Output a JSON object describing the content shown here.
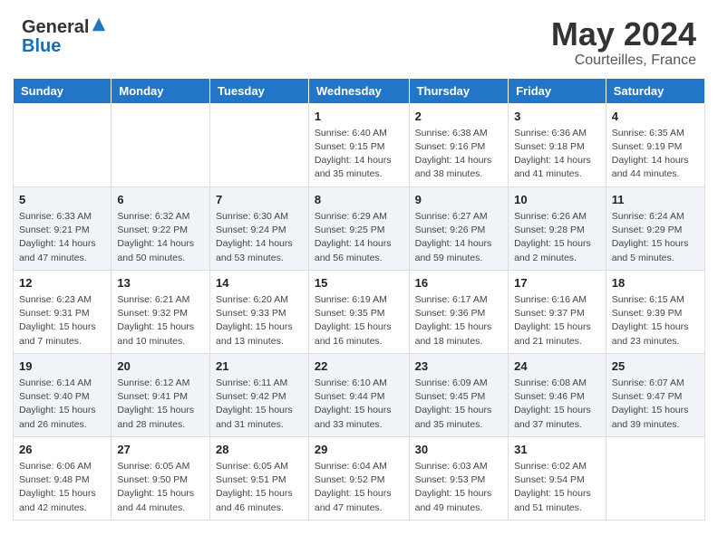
{
  "header": {
    "logo_general": "General",
    "logo_blue": "Blue",
    "month_year": "May 2024",
    "location": "Courteilles, France"
  },
  "days_of_week": [
    "Sunday",
    "Monday",
    "Tuesday",
    "Wednesday",
    "Thursday",
    "Friday",
    "Saturday"
  ],
  "weeks": [
    [
      {
        "day": "",
        "info": ""
      },
      {
        "day": "",
        "info": ""
      },
      {
        "day": "",
        "info": ""
      },
      {
        "day": "1",
        "info": "Sunrise: 6:40 AM\nSunset: 9:15 PM\nDaylight: 14 hours\nand 35 minutes."
      },
      {
        "day": "2",
        "info": "Sunrise: 6:38 AM\nSunset: 9:16 PM\nDaylight: 14 hours\nand 38 minutes."
      },
      {
        "day": "3",
        "info": "Sunrise: 6:36 AM\nSunset: 9:18 PM\nDaylight: 14 hours\nand 41 minutes."
      },
      {
        "day": "4",
        "info": "Sunrise: 6:35 AM\nSunset: 9:19 PM\nDaylight: 14 hours\nand 44 minutes."
      }
    ],
    [
      {
        "day": "5",
        "info": "Sunrise: 6:33 AM\nSunset: 9:21 PM\nDaylight: 14 hours\nand 47 minutes."
      },
      {
        "day": "6",
        "info": "Sunrise: 6:32 AM\nSunset: 9:22 PM\nDaylight: 14 hours\nand 50 minutes."
      },
      {
        "day": "7",
        "info": "Sunrise: 6:30 AM\nSunset: 9:24 PM\nDaylight: 14 hours\nand 53 minutes."
      },
      {
        "day": "8",
        "info": "Sunrise: 6:29 AM\nSunset: 9:25 PM\nDaylight: 14 hours\nand 56 minutes."
      },
      {
        "day": "9",
        "info": "Sunrise: 6:27 AM\nSunset: 9:26 PM\nDaylight: 14 hours\nand 59 minutes."
      },
      {
        "day": "10",
        "info": "Sunrise: 6:26 AM\nSunset: 9:28 PM\nDaylight: 15 hours\nand 2 minutes."
      },
      {
        "day": "11",
        "info": "Sunrise: 6:24 AM\nSunset: 9:29 PM\nDaylight: 15 hours\nand 5 minutes."
      }
    ],
    [
      {
        "day": "12",
        "info": "Sunrise: 6:23 AM\nSunset: 9:31 PM\nDaylight: 15 hours\nand 7 minutes."
      },
      {
        "day": "13",
        "info": "Sunrise: 6:21 AM\nSunset: 9:32 PM\nDaylight: 15 hours\nand 10 minutes."
      },
      {
        "day": "14",
        "info": "Sunrise: 6:20 AM\nSunset: 9:33 PM\nDaylight: 15 hours\nand 13 minutes."
      },
      {
        "day": "15",
        "info": "Sunrise: 6:19 AM\nSunset: 9:35 PM\nDaylight: 15 hours\nand 16 minutes."
      },
      {
        "day": "16",
        "info": "Sunrise: 6:17 AM\nSunset: 9:36 PM\nDaylight: 15 hours\nand 18 minutes."
      },
      {
        "day": "17",
        "info": "Sunrise: 6:16 AM\nSunset: 9:37 PM\nDaylight: 15 hours\nand 21 minutes."
      },
      {
        "day": "18",
        "info": "Sunrise: 6:15 AM\nSunset: 9:39 PM\nDaylight: 15 hours\nand 23 minutes."
      }
    ],
    [
      {
        "day": "19",
        "info": "Sunrise: 6:14 AM\nSunset: 9:40 PM\nDaylight: 15 hours\nand 26 minutes."
      },
      {
        "day": "20",
        "info": "Sunrise: 6:12 AM\nSunset: 9:41 PM\nDaylight: 15 hours\nand 28 minutes."
      },
      {
        "day": "21",
        "info": "Sunrise: 6:11 AM\nSunset: 9:42 PM\nDaylight: 15 hours\nand 31 minutes."
      },
      {
        "day": "22",
        "info": "Sunrise: 6:10 AM\nSunset: 9:44 PM\nDaylight: 15 hours\nand 33 minutes."
      },
      {
        "day": "23",
        "info": "Sunrise: 6:09 AM\nSunset: 9:45 PM\nDaylight: 15 hours\nand 35 minutes."
      },
      {
        "day": "24",
        "info": "Sunrise: 6:08 AM\nSunset: 9:46 PM\nDaylight: 15 hours\nand 37 minutes."
      },
      {
        "day": "25",
        "info": "Sunrise: 6:07 AM\nSunset: 9:47 PM\nDaylight: 15 hours\nand 39 minutes."
      }
    ],
    [
      {
        "day": "26",
        "info": "Sunrise: 6:06 AM\nSunset: 9:48 PM\nDaylight: 15 hours\nand 42 minutes."
      },
      {
        "day": "27",
        "info": "Sunrise: 6:05 AM\nSunset: 9:50 PM\nDaylight: 15 hours\nand 44 minutes."
      },
      {
        "day": "28",
        "info": "Sunrise: 6:05 AM\nSunset: 9:51 PM\nDaylight: 15 hours\nand 46 minutes."
      },
      {
        "day": "29",
        "info": "Sunrise: 6:04 AM\nSunset: 9:52 PM\nDaylight: 15 hours\nand 47 minutes."
      },
      {
        "day": "30",
        "info": "Sunrise: 6:03 AM\nSunset: 9:53 PM\nDaylight: 15 hours\nand 49 minutes."
      },
      {
        "day": "31",
        "info": "Sunrise: 6:02 AM\nSunset: 9:54 PM\nDaylight: 15 hours\nand 51 minutes."
      },
      {
        "day": "",
        "info": ""
      }
    ]
  ]
}
